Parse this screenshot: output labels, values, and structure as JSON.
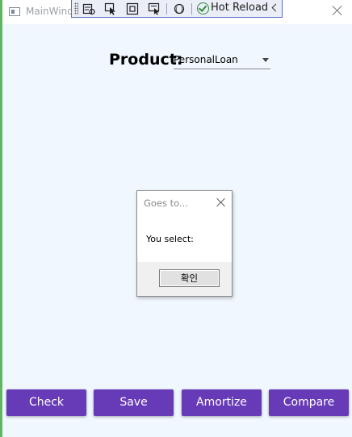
{
  "window": {
    "title": "MainWind",
    "accent_color": "#5cb85c",
    "background_color": "#f0f7fe"
  },
  "debug_toolbar": {
    "tools": [
      {
        "icon": "select-element-icon"
      },
      {
        "icon": "pointer-select-icon"
      },
      {
        "icon": "layout-adorner-icon"
      },
      {
        "icon": "track-focus-icon"
      },
      {
        "icon": "binding-failures-icon"
      }
    ],
    "hot_reload_label": "Hot Reload",
    "hot_reload_color": "#2e8b3c"
  },
  "product": {
    "label": "Product:",
    "selected": "PersonalLoan"
  },
  "dialog": {
    "title": "Goes to...",
    "message": "You select:",
    "ok_label": "확인"
  },
  "buttons": {
    "color": "#673ab7",
    "items": [
      {
        "label": "Check"
      },
      {
        "label": "Save"
      },
      {
        "label": "Amortize"
      },
      {
        "label": "Compare"
      }
    ]
  }
}
